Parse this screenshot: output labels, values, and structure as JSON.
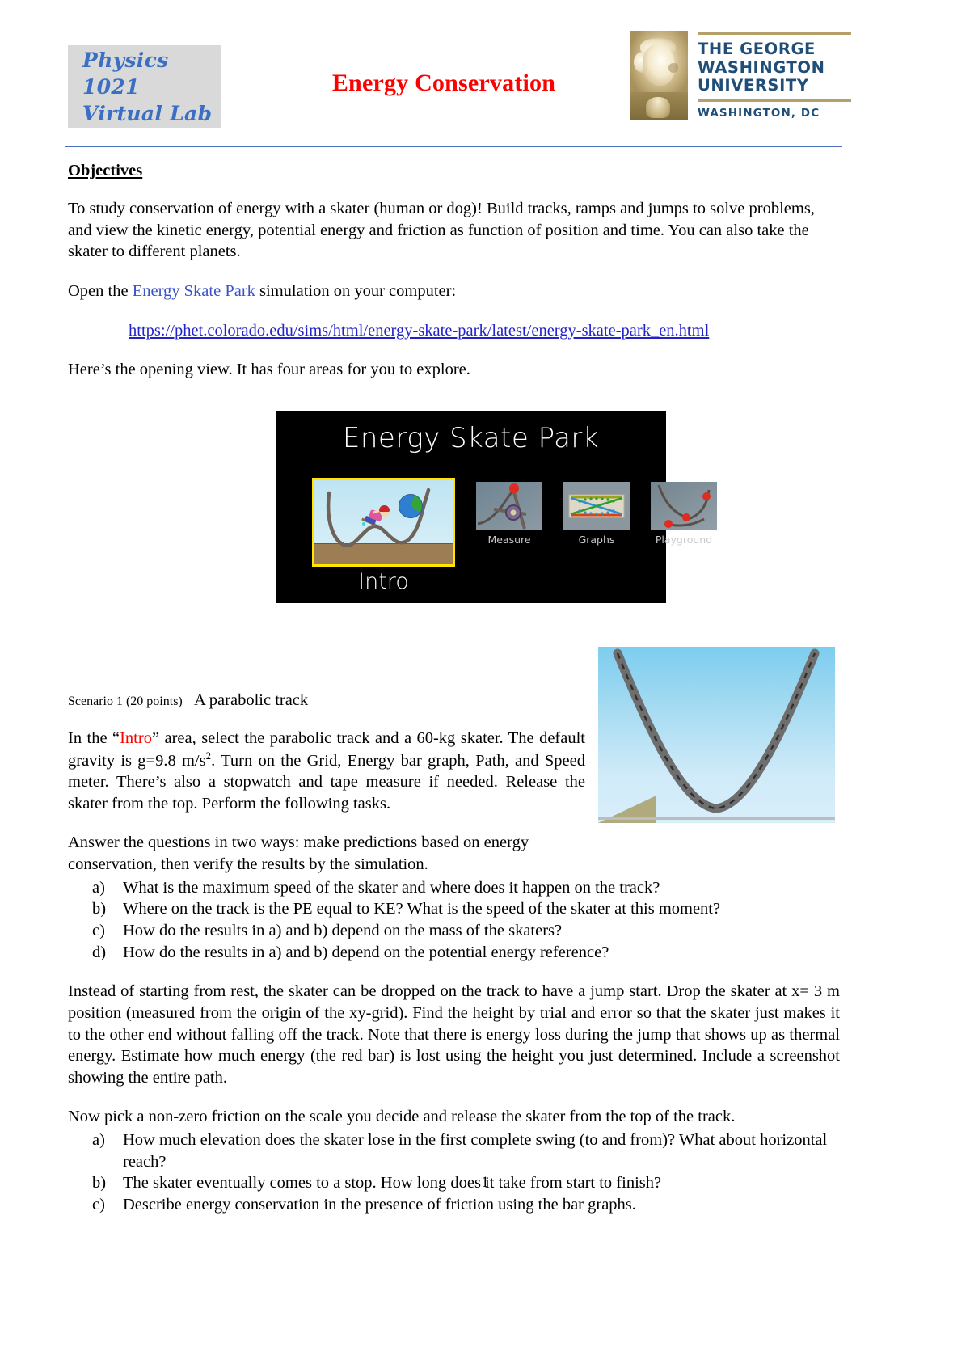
{
  "header": {
    "course_line1": "Physics 1021",
    "course_line2": "Virtual Lab",
    "title": "Energy Conservation",
    "university": {
      "line1": "THE GEORGE",
      "line2": "WASHINGTON",
      "line3": "UNIVERSITY",
      "city": "WASHINGTON, DC"
    }
  },
  "objectives": {
    "heading": "Objectives",
    "paragraph": "To study conservation of energy with a skater (human or dog)!  Build tracks, ramps and jumps to solve problems, and view the kinetic energy, potential energy and friction as function of position and time. You can also take the skater to different planets.",
    "open_prefix": "Open the ",
    "open_link": "Energy Skate Park",
    "open_suffix": " simulation on your computer:",
    "url": "https://phet.colorado.edu/sims/html/energy-skate-park/latest/energy-skate-park_en.html",
    "opening_view": "Here’s the opening view. It has four areas for you to explore."
  },
  "sim_screenshot": {
    "title": "Energy Skate Park",
    "selected_label": "Intro",
    "thumbnails": [
      {
        "label": "Measure"
      },
      {
        "label": "Graphs"
      },
      {
        "label": "Playground"
      }
    ]
  },
  "scenario1": {
    "heading": "Scenario 1 (20 points)",
    "subtitle": "A parabolic track",
    "intro_p1_a": "In the “",
    "intro_p1_red": "Intro",
    "intro_p1_b": "” area, select the parabolic track and a 60-kg skater. The default gravity is g=9.8 m/s",
    "intro_p1_sup": "2",
    "intro_p1_c": ". Turn on the Grid, Energy bar graph, Path, and Speed meter. There’s also a stopwatch and tape measure if needed. Release the skater from the top. Perform the following tasks.",
    "answer_intro": "Answer the questions in two ways: make predictions based on energy conservation, then verify the results by the simulation.",
    "questions": [
      {
        "mark": "a)",
        "text": "What is the maximum speed of the skater and where does it happen on the track?"
      },
      {
        "mark": "b)",
        "text": "Where on the track is the PE equal to KE? What is the speed of the skater at this moment?"
      },
      {
        "mark": "c)",
        "text": "How do the results in a) and b) depend on the mass of the skaters?"
      },
      {
        "mark": "d)",
        "text": "How do the results in a) and b) depend on the potential energy reference?"
      }
    ],
    "jump_paragraph": "Instead of starting from rest, the skater can be dropped on the track to have a jump start. Drop the skater at x= 3 m position (measured from the origin of the xy-grid). Find the height by trial and error so that the skater just makes it to the other end without falling off the track. Note that there is energy loss during the jump that shows up as thermal energy. Estimate how much energy (the red bar) is lost using the height you just determined. Include a screenshot showing the entire path.",
    "friction_intro": "Now pick a non-zero friction on the scale you decide and release the skater from the top of the track.",
    "friction_questions": [
      {
        "mark": "a)",
        "text": "How much elevation does the skater lose in the first complete swing (to and from)?  What about horizontal reach?"
      },
      {
        "mark": "b)",
        "text": "The skater eventually comes to a stop. How long does it take from start to finish?"
      },
      {
        "mark": "c)",
        "text": "Describe energy conservation in the presence of friction using the bar graphs."
      }
    ]
  },
  "footer": {
    "page_number": "1"
  }
}
